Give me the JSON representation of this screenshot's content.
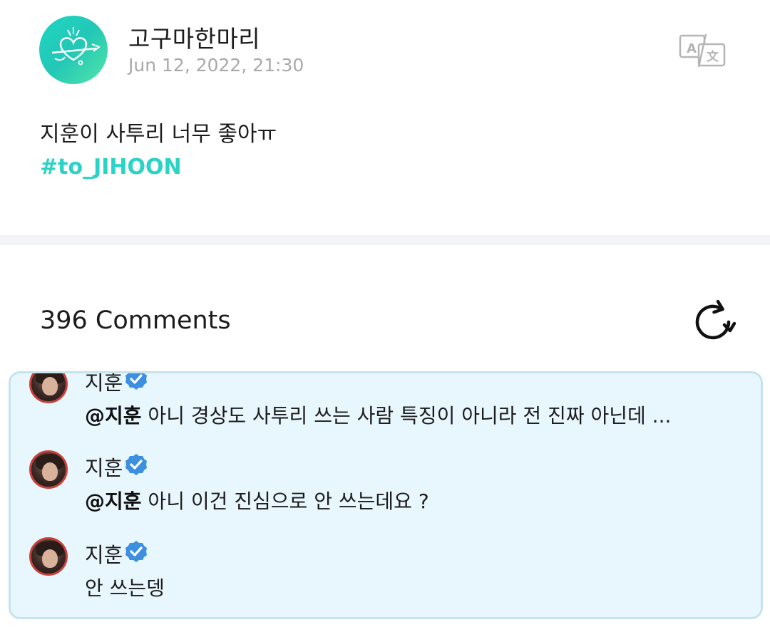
{
  "post": {
    "author_name": "고구마한마리",
    "timestamp": "Jun 12, 2022, 21:30",
    "text": "지훈이 사투리 너무 좋아ㅠ",
    "hashtag": "#to_JIHOON",
    "translate_icon": "translate-icon"
  },
  "comments_section": {
    "count_label": "396 Comments",
    "refresh_icon": "refresh-icon",
    "comments": [
      {
        "author": "지훈",
        "verified": true,
        "mention": "@지훈",
        "text": " 아니 경상도 사투리 쓰는 사람 특징이 아니라 전 진짜 아닌데 ..."
      },
      {
        "author": "지훈",
        "verified": true,
        "mention": "@지훈",
        "text": " 아니 이건 진심으로 안 쓰는데요 ?"
      },
      {
        "author": "지훈",
        "verified": true,
        "mention": "",
        "text": "안 쓰는뎅"
      }
    ]
  },
  "colors": {
    "accent": "#2ad3c6",
    "verified_badge": "#3d8fe0",
    "comment_box_bg": "#e8f6fd",
    "comment_box_border": "#c5e4ec",
    "timestamp": "#a9a9a9"
  }
}
